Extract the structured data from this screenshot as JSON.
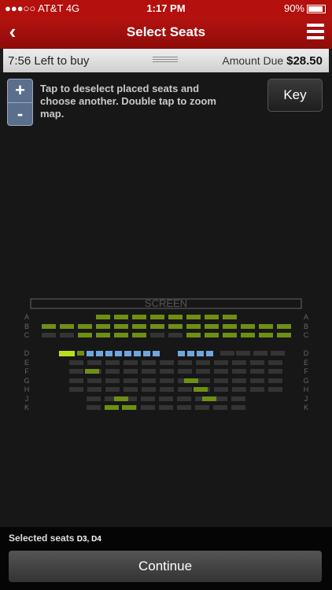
{
  "status": {
    "carrier": "●●●○○ AT&T",
    "network": "4G",
    "time": "1:17 PM",
    "battery": "90%"
  },
  "nav": {
    "title": "Select Seats",
    "back_icon": "‹"
  },
  "timer": {
    "text": "7:56 Left to buy",
    "amount_label": "Amount Due",
    "amount_value": "$28.50"
  },
  "zoom": {
    "plus": "+",
    "minus": "-"
  },
  "instructions": "Tap to deselect placed seats and choose another. Double tap to zoom map.",
  "key_label": "Key",
  "screen_label": "SCREEN",
  "row_labels": [
    "A",
    "B",
    "C",
    "D",
    "E",
    "F",
    "G",
    "H",
    "J",
    "K"
  ],
  "accessible_glyph": "♿",
  "selected_seats": {
    "label": "Selected seats",
    "value": "D3, D4"
  },
  "continue_label": "Continue",
  "colors": {
    "statusbar": "#b3100e",
    "navbar": "#a01110",
    "available_seat": "#6f8f14",
    "unavailable_seat": "#343434",
    "selected_seat": "#b8e01a",
    "accessible_seat": "#6fa8dc"
  }
}
